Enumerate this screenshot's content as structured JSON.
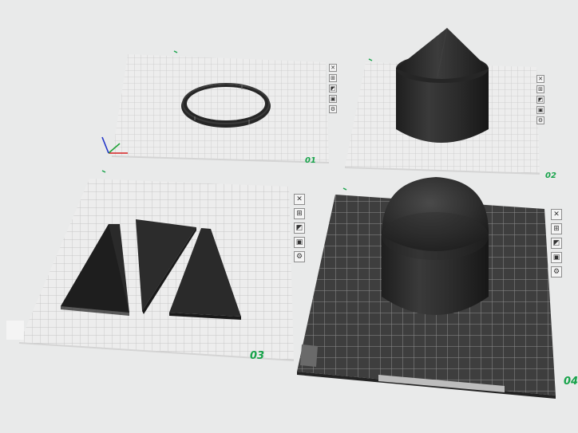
{
  "plates": [
    {
      "id": "plate-01",
      "number_label": "01",
      "object": "ring",
      "selected": false,
      "tool_icons": [
        "close-icon",
        "arrange-icon",
        "orient-icon",
        "lock-icon",
        "settings-icon"
      ]
    },
    {
      "id": "plate-02",
      "number_label": "02",
      "object": "cone-topped cylinder",
      "selected": false,
      "tool_icons": [
        "close-icon",
        "arrange-icon",
        "orient-icon",
        "lock-icon",
        "settings-icon"
      ]
    },
    {
      "id": "plate-03",
      "number_label": "03",
      "object": "three trapezoid pieces",
      "selected": false,
      "tool_icons": [
        "close-icon",
        "arrange-icon",
        "orient-icon",
        "lock-icon",
        "settings-icon"
      ]
    },
    {
      "id": "plate-04",
      "number_label": "04",
      "object": "dome-topped cylinder",
      "selected": true,
      "tool_icons": [
        "close-icon",
        "arrange-icon",
        "orient-icon",
        "lock-icon",
        "settings-icon"
      ]
    }
  ],
  "icons": {
    "close-icon": "✕",
    "arrange-icon": "⊞",
    "orient-icon": "◩",
    "lock-icon": "▣",
    "settings-icon": "⚙"
  },
  "axes_icon": "xyz-axes-icon",
  "colors": {
    "background": "#e9eaea",
    "plate_light": "#ededed",
    "plate_grid": "#c9c9c9",
    "plate_dark": "#3c3c3c",
    "plate_dark_grid": "#8a8a8a",
    "model": "#2a2a2a",
    "plate_number": "#17a34a",
    "axis_x": "#d62020",
    "axis_y": "#22a33a",
    "axis_z": "#2234c8"
  }
}
